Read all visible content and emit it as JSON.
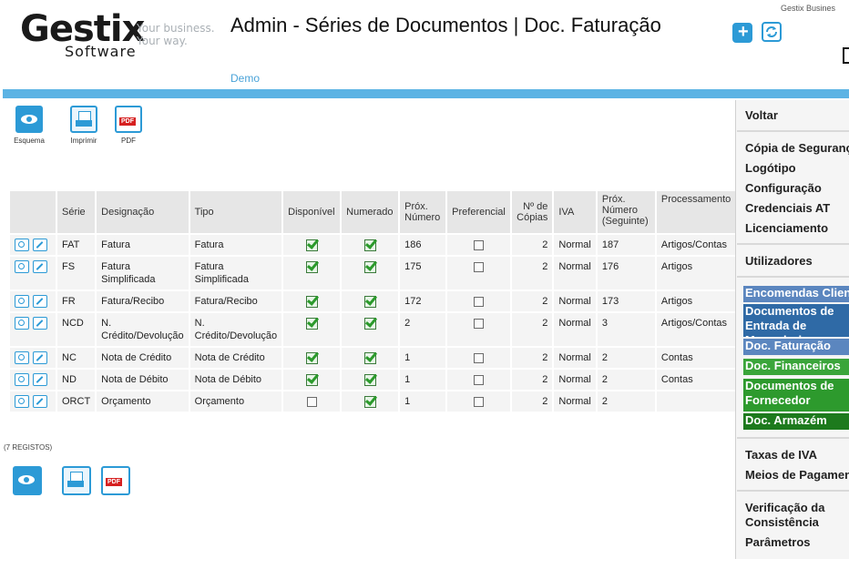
{
  "header": {
    "logo_main": "Gestix",
    "logo_sub": "Software",
    "logo_tagline_1": "Your business.",
    "logo_tagline_2": "Your way.",
    "title": "Admin - Séries de Documentos | Doc. Faturação",
    "demo_link": "Demo",
    "corner_text": "Gestix Busines",
    "add_icon": "plus-icon",
    "sync_icon": "refresh-icon"
  },
  "colors": {
    "accent": "#2c9ad6",
    "bar": "#5cb3e4",
    "nav_blue": "#2f6aa6",
    "nav_light_blue": "#5b86bf",
    "nav_green": "#2d9a2d",
    "nav_dark_green": "#1d7a1d"
  },
  "toolbar": {
    "schema_label": "Esquema",
    "print_label": "Imprimir",
    "pdf_label": "PDF",
    "pdf_badge": "PDF"
  },
  "table": {
    "headers": [
      "",
      "Série",
      "Designação",
      "Tipo",
      "Disponível",
      "Numerado",
      "Próx. Número",
      "Preferencial",
      "Nº de Cópias",
      "IVA",
      "Próx. Número (Seguinte)",
      "Processamento"
    ],
    "rows": [
      {
        "serie": "FAT",
        "designacao": "Fatura",
        "tipo": "Fatura",
        "disponivel": true,
        "numerado": true,
        "prox": "186",
        "preferencial": false,
        "copias": "2",
        "iva": "Normal",
        "prox_seg": "187",
        "proc": "Artigos/Contas"
      },
      {
        "serie": "FS",
        "designacao": "Fatura Simplificada",
        "tipo": "Fatura Simplificada",
        "disponivel": true,
        "numerado": true,
        "prox": "175",
        "preferencial": false,
        "copias": "2",
        "iva": "Normal",
        "prox_seg": "176",
        "proc": "Artigos"
      },
      {
        "serie": "FR",
        "designacao": "Fatura/Recibo",
        "tipo": "Fatura/Recibo",
        "disponivel": true,
        "numerado": true,
        "prox": "172",
        "preferencial": false,
        "copias": "2",
        "iva": "Normal",
        "prox_seg": "173",
        "proc": "Artigos"
      },
      {
        "serie": "NCD",
        "designacao": "N. Crédito/Devolução",
        "tipo": "N. Crédito/Devolução",
        "disponivel": true,
        "numerado": true,
        "prox": "2",
        "preferencial": false,
        "copias": "2",
        "iva": "Normal",
        "prox_seg": "3",
        "proc": "Artigos/Contas"
      },
      {
        "serie": "NC",
        "designacao": "Nota de Crédito",
        "tipo": "Nota de Crédito",
        "disponivel": true,
        "numerado": true,
        "prox": "1",
        "preferencial": false,
        "copias": "2",
        "iva": "Normal",
        "prox_seg": "2",
        "proc": "Contas"
      },
      {
        "serie": "ND",
        "designacao": "Nota de Débito",
        "tipo": "Nota de Débito",
        "disponivel": true,
        "numerado": true,
        "prox": "1",
        "preferencial": false,
        "copias": "2",
        "iva": "Normal",
        "prox_seg": "2",
        "proc": "Contas"
      },
      {
        "serie": "ORCT",
        "designacao": "Orçamento",
        "tipo": "Orçamento",
        "disponivel": false,
        "numerado": true,
        "prox": "1",
        "preferencial": false,
        "copias": "2",
        "iva": "Normal",
        "prox_seg": "2",
        "proc": ""
      }
    ]
  },
  "records_label": "(7 REGISTOS)",
  "sidebar": {
    "voltar": "Voltar",
    "group1": [
      "Cópia de Segurança",
      "Logótipo",
      "Configuração",
      "Credenciais AT",
      "Licenciamento"
    ],
    "utilizadores": "Utilizadores",
    "colored": [
      {
        "label": "Encomendas Clientes",
        "color": "#5b86bf"
      },
      {
        "label": "Documentos de Entrada de Mercadorias",
        "color": "#2f6aa6"
      },
      {
        "label": "Doc. Faturação",
        "color": "#5b86bf"
      },
      {
        "label": "Doc. Financeiros",
        "color": "#3aa53a"
      },
      {
        "label": "Documentos de Fornecedor",
        "color": "#2d9a2d"
      },
      {
        "label": "Doc. Armazém",
        "color": "#1d7a1d"
      }
    ],
    "group2": [
      "Taxas de IVA",
      "Meios de Pagamento"
    ],
    "group3": [
      "Verificação da Consistência",
      "Parâmetros"
    ]
  }
}
